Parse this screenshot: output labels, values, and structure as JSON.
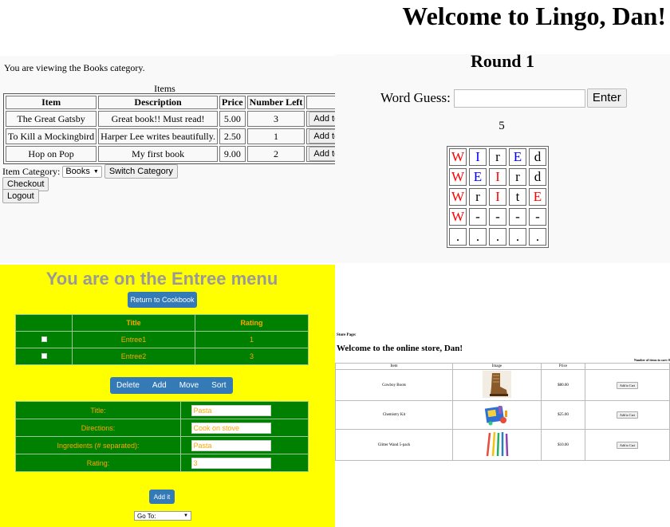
{
  "books": {
    "view_text": "You are viewing the Books category.",
    "table_caption": "Items",
    "headers": [
      "Item",
      "Description",
      "Price",
      "Number Left",
      ""
    ],
    "rows": [
      {
        "item": "The Great Gatsby",
        "description": "Great book!! Must read!",
        "price": "5.00",
        "left": "3",
        "button": "Add to Cart"
      },
      {
        "item": "To Kill a Mockingbird",
        "description": "Harper Lee writes beautifully.",
        "price": "2.50",
        "left": "1",
        "button": "Add to Cart"
      },
      {
        "item": "Hop on Pop",
        "description": "My first book",
        "price": "9.00",
        "left": "2",
        "button": "Add to Cart"
      }
    ],
    "category_label": "Item Category:",
    "category_value": "Books",
    "switch_label": "Switch Category",
    "checkout_label": "Checkout",
    "logout_label": "Logout"
  },
  "lingo": {
    "welcome": "Welcome to Lingo, Dan!",
    "round": "Round 1",
    "guess_label": "Word Guess:",
    "enter_label": "Enter",
    "count": "5",
    "colors": {
      "red": "#ff0000",
      "blue": "#0000ff",
      "black": "#000000"
    },
    "grid": [
      [
        {
          "l": "W",
          "c": "red"
        },
        {
          "l": "I",
          "c": "blue"
        },
        {
          "l": "r",
          "c": "black"
        },
        {
          "l": "E",
          "c": "blue"
        },
        {
          "l": "d",
          "c": "black"
        }
      ],
      [
        {
          "l": "W",
          "c": "red"
        },
        {
          "l": "E",
          "c": "blue"
        },
        {
          "l": "I",
          "c": "red"
        },
        {
          "l": "r",
          "c": "black"
        },
        {
          "l": "d",
          "c": "black"
        }
      ],
      [
        {
          "l": "W",
          "c": "red"
        },
        {
          "l": "r",
          "c": "black"
        },
        {
          "l": "I",
          "c": "red"
        },
        {
          "l": "t",
          "c": "black"
        },
        {
          "l": "E",
          "c": "red"
        }
      ],
      [
        {
          "l": "W",
          "c": "red"
        },
        {
          "l": "-",
          "c": "black"
        },
        {
          "l": "-",
          "c": "black"
        },
        {
          "l": "-",
          "c": "black"
        },
        {
          "l": "-",
          "c": "black"
        }
      ],
      [
        {
          "l": ".",
          "c": "black"
        },
        {
          "l": ".",
          "c": "black"
        },
        {
          "l": ".",
          "c": "black"
        },
        {
          "l": ".",
          "c": "black"
        },
        {
          "l": ".",
          "c": "black"
        }
      ]
    ]
  },
  "cookbook": {
    "heading": "You are on the Entree menu",
    "return_label": "Return to Cookbook",
    "headers": [
      "",
      "Title",
      "Rating"
    ],
    "recipes": [
      {
        "title": "Entree1",
        "rating": "1"
      },
      {
        "title": "Entree2",
        "rating": "3"
      }
    ],
    "actions": [
      "Delete",
      "Add",
      "Move",
      "Sort"
    ],
    "form": {
      "title_label": "Title:",
      "title_value": "Pasta",
      "directions_label": "Directions:",
      "directions_value": "Cook on stove",
      "ingredients_label": "Ingredients (# separated):",
      "ingredients_value": "Pasta",
      "rating_label": "Rating:",
      "rating_value": "3"
    },
    "add_label": "Add it",
    "goto_label": "Go To:"
  },
  "store": {
    "label": "Store Page:",
    "title": "Welcome to the online store, Dan!",
    "cart_label": "Number of items in cart: 0",
    "headers": [
      "Item",
      "Image",
      "Price",
      ""
    ],
    "rows": [
      {
        "item": "Cowboy Boots",
        "image": "boot-image",
        "price": "$80.00",
        "button": "Add to Cart"
      },
      {
        "item": "Chemistry Kit",
        "image": "chemistry-kit-image",
        "price": "$25.00",
        "button": "Add to Cart"
      },
      {
        "item": "Glitter Wand 5-pack",
        "image": "glitter-wand-image",
        "price": "$10.00",
        "button": "Add to Cart"
      }
    ]
  }
}
